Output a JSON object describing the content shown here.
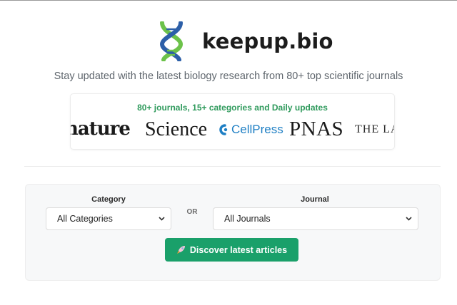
{
  "brand": {
    "name": "keepup.bio",
    "logo_icon": "dna-icon"
  },
  "tagline": "Stay updated with the latest biology research from 80+ top scientific journals",
  "journals": {
    "headline": "80+ journals, 15+ categories and Daily updates",
    "logos": [
      "nature",
      "Science",
      "CellPress",
      "PNAS",
      "THE LA"
    ]
  },
  "search": {
    "category_label": "Category",
    "category_value": "All Categories",
    "or_label": "OR",
    "journal_label": "Journal",
    "journal_value": "All Journals",
    "discover_button": "Discover latest articles",
    "discover_icon": "rocket-icon"
  },
  "colors": {
    "accent_green": "#1aa06a",
    "headline_green": "#2f9a5c",
    "dna_blue": "#2c5fa8",
    "dna_green": "#6cc24a",
    "cellpress_blue": "#1e7fc4"
  }
}
